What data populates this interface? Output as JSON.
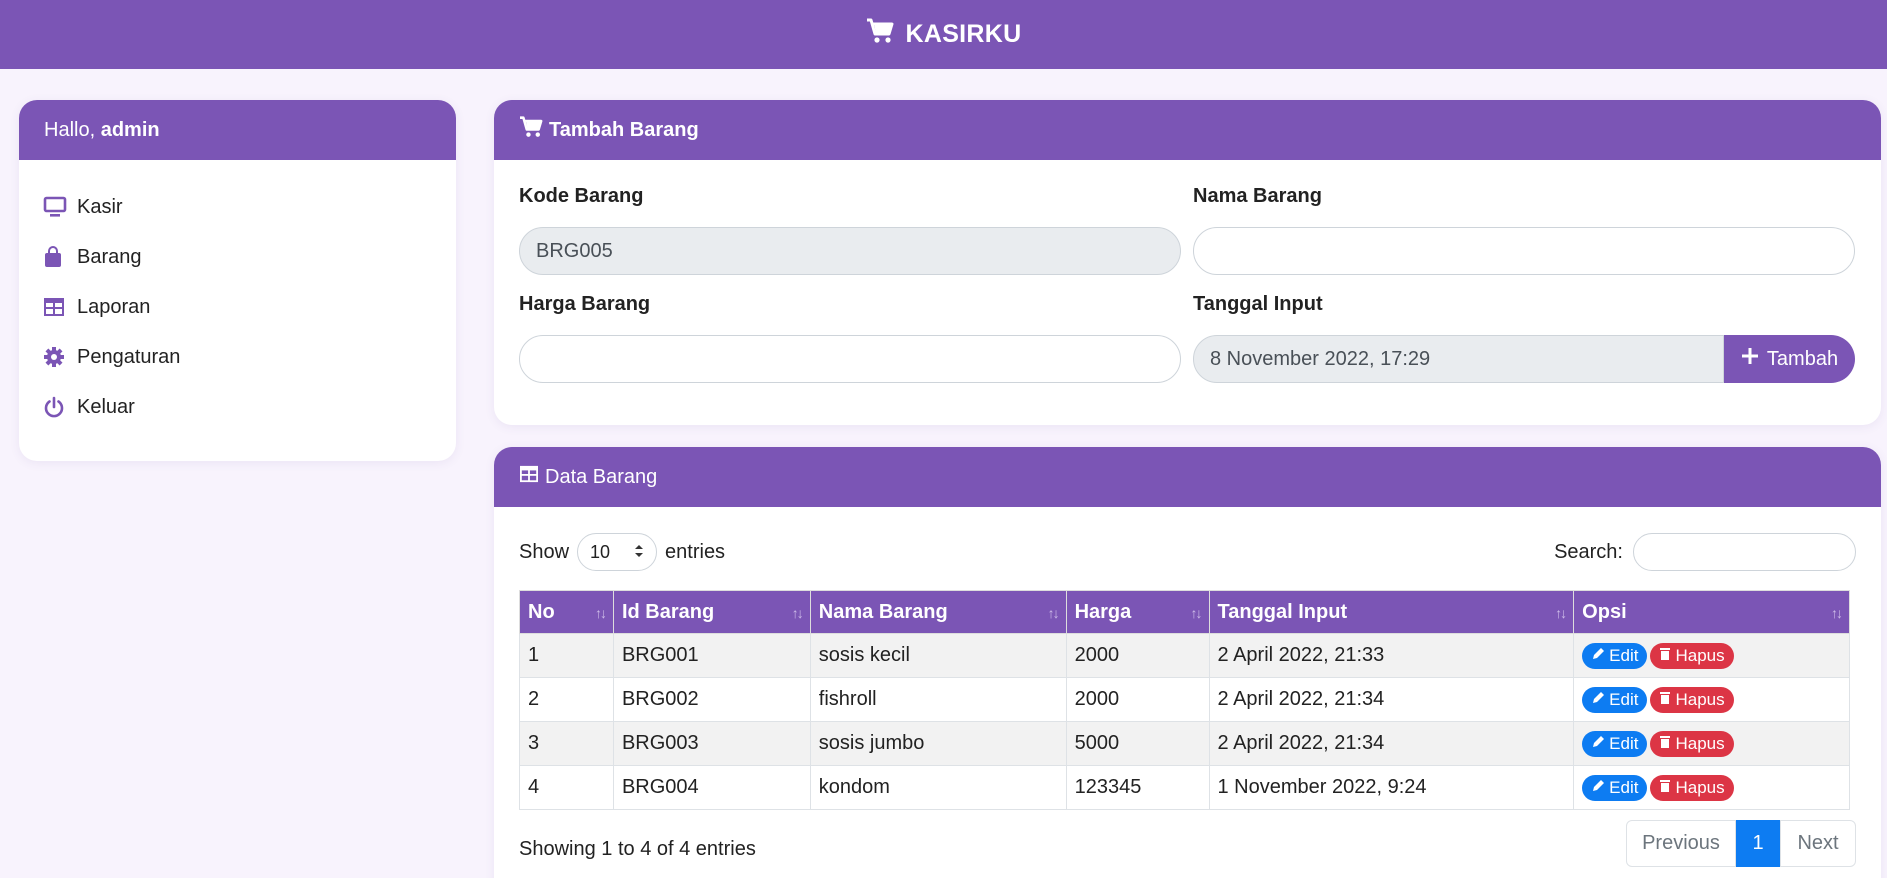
{
  "app": {
    "title": "KASIRKU"
  },
  "sidebar": {
    "greeting": "Hallo,",
    "user": "admin",
    "items": [
      {
        "label": "Kasir",
        "icon": "monitor-icon"
      },
      {
        "label": "Barang",
        "icon": "shopping-bag-icon"
      },
      {
        "label": "Laporan",
        "icon": "table-icon"
      },
      {
        "label": "Pengaturan",
        "icon": "gear-icon"
      },
      {
        "label": "Keluar",
        "icon": "power-icon"
      }
    ]
  },
  "form": {
    "title": "Tambah Barang",
    "kode_label": "Kode Barang",
    "kode_value": "BRG005",
    "nama_label": "Nama Barang",
    "nama_value": "",
    "harga_label": "Harga Barang",
    "harga_value": "",
    "tanggal_label": "Tanggal Input",
    "tanggal_value": "8 November 2022, 17:29",
    "submit_label": "Tambah"
  },
  "data": {
    "title": "Data Barang",
    "show_label": "Show",
    "entries_value": "10",
    "entries_label": "entries",
    "search_label": "Search:",
    "columns": [
      "No",
      "Id Barang",
      "Nama Barang",
      "Harga",
      "Tanggal Input",
      "Opsi"
    ],
    "rows": [
      {
        "no": "1",
        "id": "BRG001",
        "nama": "sosis kecil",
        "harga": "2000",
        "tanggal": "2 April 2022, 21:33"
      },
      {
        "no": "2",
        "id": "BRG002",
        "nama": "fishroll",
        "harga": "2000",
        "tanggal": "2 April 2022, 21:34"
      },
      {
        "no": "3",
        "id": "BRG003",
        "nama": "sosis jumbo",
        "harga": "5000",
        "tanggal": "2 April 2022, 21:34"
      },
      {
        "no": "4",
        "id": "BRG004",
        "nama": "kondom",
        "harga": "123345",
        "tanggal": "1 November 2022, 9:24"
      }
    ],
    "edit_label": "Edit",
    "hapus_label": "Hapus",
    "info": "Showing 1 to 4 of 4 entries",
    "pagination": {
      "prev": "Previous",
      "current": "1",
      "next": "Next"
    }
  },
  "colors": {
    "accent": "#7b55b5",
    "edit": "#0d7cf2",
    "delete": "#dc3545"
  }
}
